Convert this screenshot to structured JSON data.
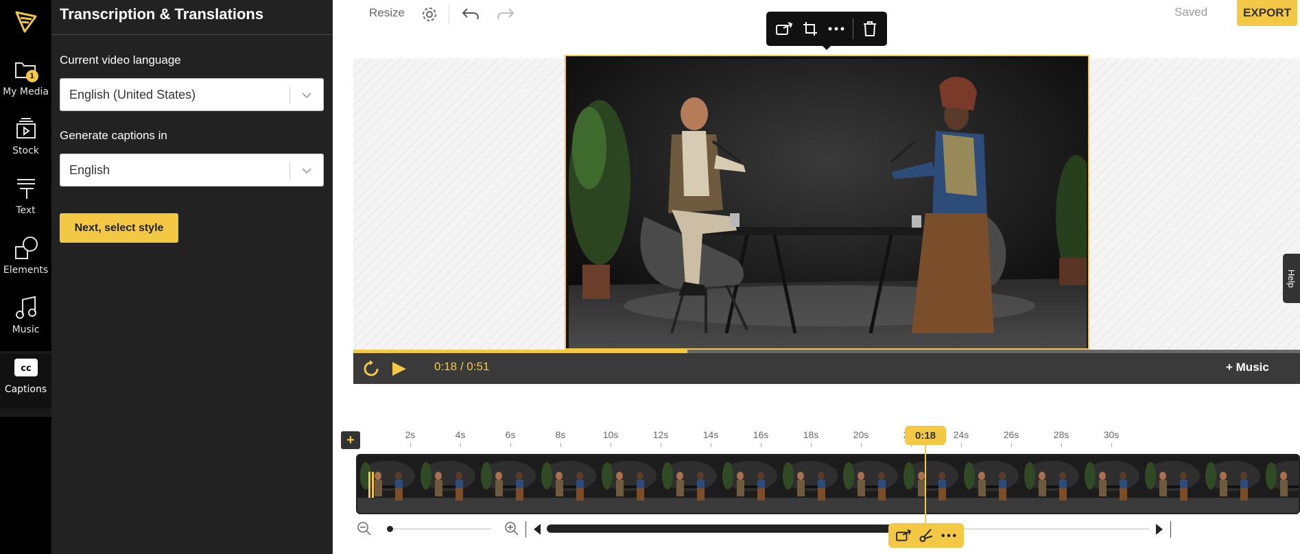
{
  "rail": {
    "items": [
      {
        "label": "My Media",
        "icon": "folder-icon",
        "badge": "1"
      },
      {
        "label": "Stock",
        "icon": "film-stack-icon"
      },
      {
        "label": "Text",
        "icon": "text-icon"
      },
      {
        "label": "Elements",
        "icon": "shapes-icon"
      },
      {
        "label": "Music",
        "icon": "music-note-icon"
      },
      {
        "label": "Captions",
        "icon": "cc-icon",
        "active": true
      }
    ]
  },
  "panel": {
    "title": "Transcription & Translations",
    "video_language_label": "Current video language",
    "video_language_value": "English (United States)",
    "captions_language_label": "Generate captions in",
    "captions_language_value": "English",
    "next_button": "Next, select style"
  },
  "topbar": {
    "resize_label": "Resize",
    "saved_label": "Saved",
    "export_label": "EXPORT"
  },
  "help_tab": "Help",
  "player": {
    "current_time": "0:18",
    "separator": "/",
    "duration": "0:51",
    "progress_fraction": 0.353,
    "music_button": "+ Music"
  },
  "timeline": {
    "ticks": [
      "2s",
      "4s",
      "6s",
      "8s",
      "10s",
      "12s",
      "14s",
      "16s",
      "18s",
      "20s",
      "22s",
      "24s",
      "26s",
      "28s",
      "30s"
    ],
    "playhead_label": "0:18",
    "add_button": "+"
  },
  "colors": {
    "accent": "#f3c845",
    "rail_bg": "#000000",
    "panel_bg": "#222222",
    "player_bg": "#3a3a3a"
  }
}
